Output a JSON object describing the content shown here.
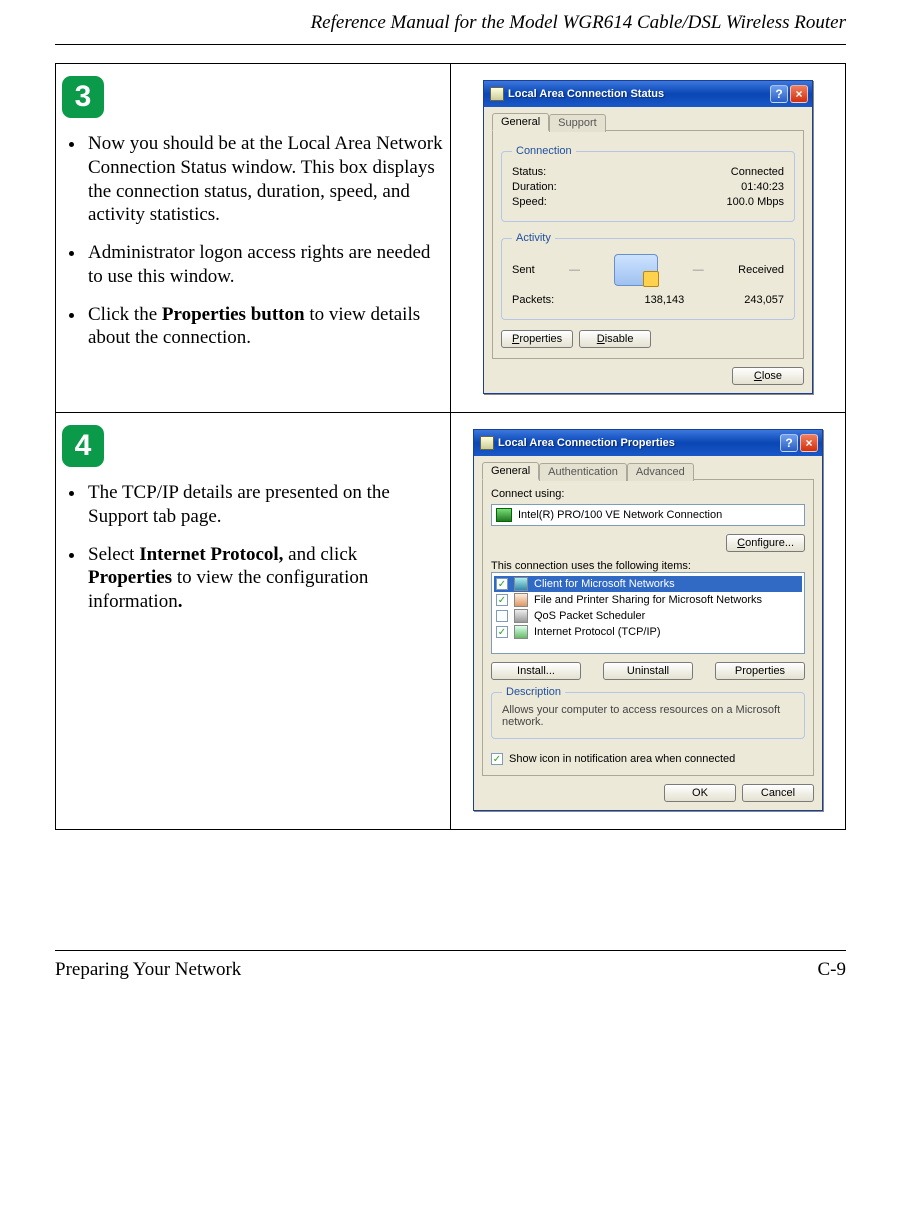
{
  "doc": {
    "header": "Reference Manual for the Model WGR614 Cable/DSL Wireless Router",
    "footer_left": "Preparing Your Network",
    "footer_right": "C-9"
  },
  "step3": {
    "badge": "3",
    "bullet1_a": "Now you should be at the Local Area Network Connection Status window. This box displays the connection status, duration, speed, and activity statistics.",
    "bullet2": "Administrator logon access rights are needed to use this window.",
    "bullet3_a": "Click the ",
    "bullet3_b": "Properties button",
    "bullet3_c": " to view details about the connection."
  },
  "step4": {
    "badge": "4",
    "bullet1": "The TCP/IP details are presented on the Support tab page.",
    "bullet2_a": "Select ",
    "bullet2_b": "Internet Protocol,",
    "bullet2_c": " and click ",
    "bullet2_d": "Properties",
    "bullet2_e": " to view the configuration information",
    "bullet2_f": "."
  },
  "dlg1": {
    "title": "Local Area Connection Status",
    "help": "?",
    "close": "×",
    "tab_general": "General",
    "tab_support": "Support",
    "grp_conn": "Connection",
    "lbl_status": "Status:",
    "val_status": "Connected",
    "lbl_duration": "Duration:",
    "val_duration": "01:40:23",
    "lbl_speed": "Speed:",
    "val_speed": "100.0 Mbps",
    "grp_activity": "Activity",
    "lbl_sent": "Sent",
    "lbl_received": "Received",
    "lbl_packets": "Packets:",
    "val_sent": "138,143",
    "val_received": "243,057",
    "btn_properties": "Properties",
    "btn_disable": "Disable",
    "btn_close": "Close",
    "dash": "—"
  },
  "dlg2": {
    "title": "Local Area Connection Properties",
    "help": "?",
    "close": "×",
    "tab_general": "General",
    "tab_auth": "Authentication",
    "tab_adv": "Advanced",
    "lbl_connect_using": "Connect using:",
    "adapter": "Intel(R) PRO/100 VE Network Connection",
    "btn_configure": "Configure...",
    "lbl_items": "This connection uses the following items:",
    "item1": "Client for Microsoft Networks",
    "item2": "File and Printer Sharing for Microsoft Networks",
    "item3": "QoS Packet Scheduler",
    "item4": "Internet Protocol (TCP/IP)",
    "btn_install": "Install...",
    "btn_uninstall": "Uninstall",
    "btn_props": "Properties",
    "grp_desc": "Description",
    "desc": "Allows your computer to access resources on a Microsoft network.",
    "chk_show": "Show icon in notification area when connected",
    "btn_ok": "OK",
    "btn_cancel": "Cancel",
    "check": "✓"
  }
}
